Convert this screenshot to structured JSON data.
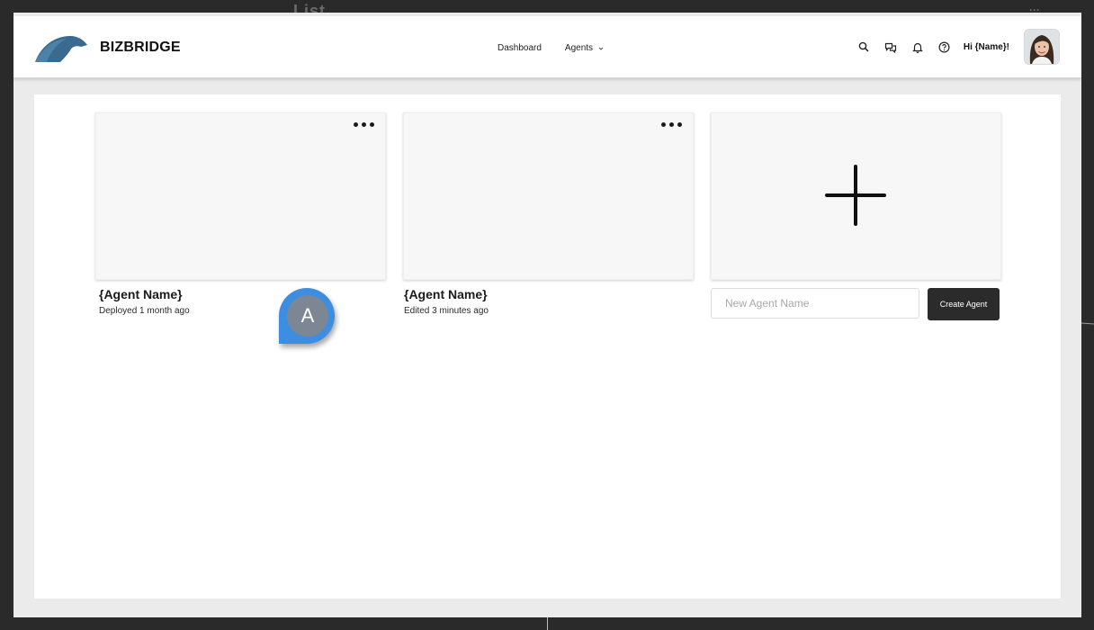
{
  "background_text": {
    "list": "List",
    "dots": "···"
  },
  "header": {
    "brand": "BIZBRIDGE",
    "nav": [
      {
        "label": "Dashboard"
      },
      {
        "label": "Agents"
      }
    ],
    "greeting": "Hi {Name}!",
    "icons": [
      "search-icon",
      "chat-icon",
      "bell-icon",
      "help-icon"
    ]
  },
  "agents": [
    {
      "name": "{Agent Name}",
      "status": "Deployed 1 month ago"
    },
    {
      "name": "{Agent Name}",
      "status": "Edited 3 minutes ago"
    }
  ],
  "create": {
    "placeholder": "New Agent Name",
    "button_label": "Create Agent"
  },
  "cursor": {
    "initial": "A"
  },
  "colors": {
    "logo": "#3a6a8f",
    "cursor": "#3d8ee0",
    "button": "#2b2b2b"
  }
}
